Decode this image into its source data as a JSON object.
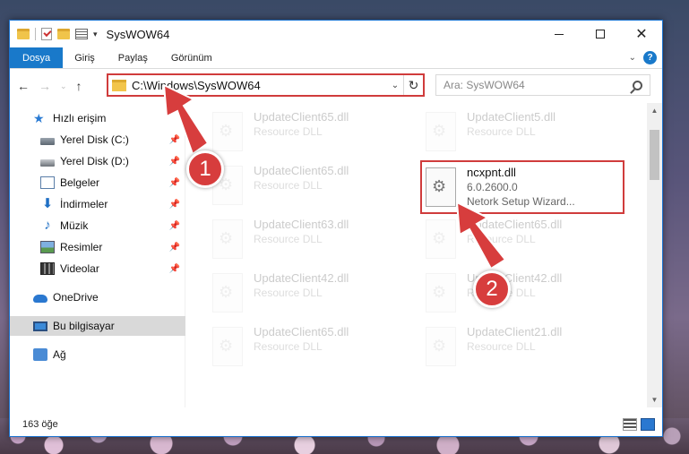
{
  "window": {
    "title": "SysWOW64"
  },
  "ribbon": {
    "tabs": [
      "Dosya",
      "Giriş",
      "Paylaş",
      "Görünüm"
    ]
  },
  "address": {
    "path": "C:\\Windows\\SysWOW64"
  },
  "search": {
    "placeholder": "Ara: SysWOW64"
  },
  "sidebar": {
    "items": [
      {
        "label": "Hızlı erişim",
        "icon": "star-icon",
        "pinned": false
      },
      {
        "label": "Yerel Disk (C:)",
        "icon": "drive-icon",
        "pinned": true
      },
      {
        "label": "Yerel Disk (D:)",
        "icon": "drive-icon",
        "pinned": true
      },
      {
        "label": "Belgeler",
        "icon": "documents-icon",
        "pinned": true
      },
      {
        "label": "İndirmeler",
        "icon": "downloads-icon",
        "pinned": true
      },
      {
        "label": "Müzik",
        "icon": "music-icon",
        "pinned": true
      },
      {
        "label": "Resimler",
        "icon": "pictures-icon",
        "pinned": true
      },
      {
        "label": "Videolar",
        "icon": "videos-icon",
        "pinned": true
      },
      {
        "label": "OneDrive",
        "icon": "onedrive-icon",
        "pinned": false
      },
      {
        "label": "Bu bilgisayar",
        "icon": "this-pc-icon",
        "pinned": false
      },
      {
        "label": "Ağ",
        "icon": "network-icon",
        "pinned": false
      }
    ]
  },
  "files": {
    "left": [
      {
        "name": "UpdateClient65.dll",
        "type": "Resource DLL"
      },
      {
        "name": "UpdateClient65.dll",
        "type": "Resource DLL"
      },
      {
        "name": "UpdateClient63.dll",
        "type": "Resource DLL"
      },
      {
        "name": "UpdateClient42.dll",
        "type": "Resource DLL"
      },
      {
        "name": "UpdateClient65.dll",
        "type": "Resource DLL"
      }
    ],
    "right": [
      {
        "name": "UpdateClient5.dll",
        "type": "Resource DLL"
      },
      {
        "name": "UpdateClient65.dll",
        "type": "Resource DLL"
      },
      {
        "name": "UpdateClient42.dll",
        "type": "Resource DLL"
      },
      {
        "name": "UpdateClient21.dll",
        "type": "Resource DLL"
      }
    ],
    "highlighted": {
      "name": "ncxpnt.dll",
      "version": "6.0.2600.0",
      "description": "Netork Setup Wizard..."
    }
  },
  "status": {
    "item_count": "163 öğe"
  },
  "annotations": {
    "step1": "1",
    "step2": "2",
    "color": "#d73d3d"
  }
}
